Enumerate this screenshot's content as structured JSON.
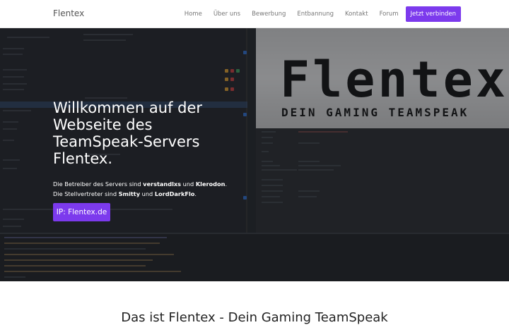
{
  "navbar": {
    "brand": "Flentex",
    "links": [
      "Home",
      "Über uns",
      "Bewerbung",
      "Entbannung",
      "Kontakt",
      "Forum"
    ],
    "cta": "Jetzt verbinden"
  },
  "hero": {
    "title": "Willkommen auf der Webseite des TeamSpeak-Servers Flentex.",
    "owners_prefix": "Die Betreiber des Servers sind ",
    "owner1": "verstandlxs",
    "owners_and": " und ",
    "owner2": "Klerodon",
    "owners_suffix": ".",
    "deputies_prefix": "Die Stellvertreter sind ",
    "deputy1": "Smitty",
    "deputies_and": " und ",
    "deputy2": "LordDarkFlo",
    "deputies_suffix": ".",
    "ip_button": "IP: Flentex.de",
    "background_logo": "Flentex",
    "background_tagline": "DEIN GAMING TEAMSPEAK"
  },
  "section": {
    "title": "Das ist Flentex - Dein Gaming TeamSpeak"
  },
  "colors": {
    "accent": "#7c3aed"
  }
}
